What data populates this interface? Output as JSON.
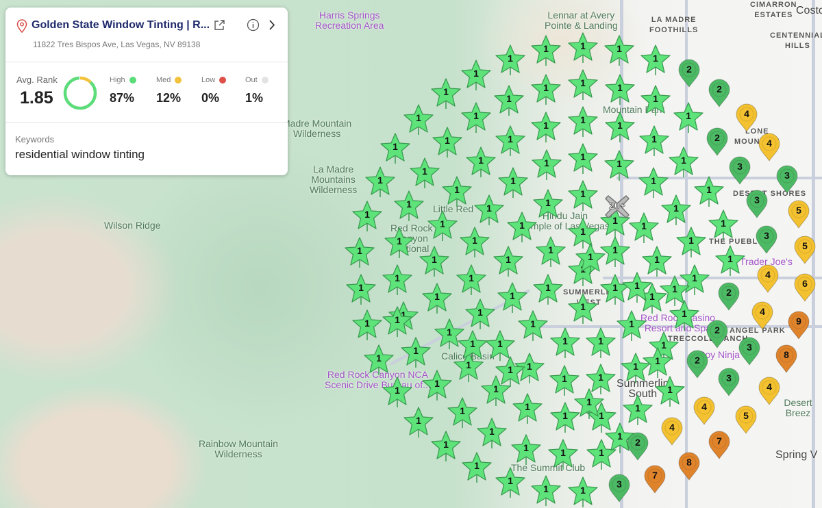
{
  "card": {
    "business_name": "Golden State Window Tinting | R...",
    "address": "11822 Tres Bispos Ave, Las Vegas, NV 89138",
    "avg_rank_label": "Avg. Rank",
    "avg_rank": "1.85",
    "stats": [
      {
        "label": "High",
        "value": "87%",
        "color": "#5ddc7a",
        "fraction": 0.87
      },
      {
        "label": "Med",
        "value": "12%",
        "color": "#f3c23c",
        "fraction": 0.12
      },
      {
        "label": "Low",
        "value": "0%",
        "color": "#e0504a",
        "fraction": 0
      },
      {
        "label": "Out",
        "value": "1%",
        "color": "#e3e3e3",
        "fraction": 0.01
      }
    ],
    "keywords_label": "Keywords",
    "keyword": "residential window tinting"
  },
  "map_labels": [
    "Harris Springs\nRecreation Area",
    "Lennar at Avery\nPointe & Landing",
    "LA MADRE\nFOOTHILLS",
    "CIMARRON\nESTATES",
    "Costc",
    "CENTENNIAL\nHILLS",
    "Madre Mountain\nWilderness",
    "La Madre\nMountains\nWilderness",
    "Wilson Ridge",
    "Little Red",
    "Red Rock\nCanyon\nNational",
    "Hindu Jain\nTemple of Las Vegas",
    "Mountain Park",
    "LONE\nMOUNTAIN",
    "DESERT SHORES",
    "THE PUEBLO",
    "SUMMERLIN\nWEST",
    "Red Rock Casino\nResort and Spa",
    "Calico Basin",
    "Red Rock Canyon NCA\nScenic Drive Bureau of...",
    "Summerlin\nSouth",
    "Rainbow Mountain\nWilderness",
    "The Summit Club",
    "Spring V",
    "Trader Joe's",
    "Soy Ninja",
    "Desert Breez",
    "ANGEL PARK",
    "TRECCOLE RANCH"
  ],
  "cluster_label": "20+",
  "star_ranks": [
    1,
    1,
    1,
    1,
    1,
    1,
    1,
    1,
    1,
    1,
    1,
    1,
    1,
    1,
    1,
    1,
    1,
    1,
    1,
    1,
    1,
    1,
    1,
    1,
    1,
    1,
    1,
    1,
    1,
    1,
    1,
    1,
    1,
    1,
    1,
    1,
    1,
    1,
    1,
    1,
    1,
    1,
    1,
    1,
    1,
    1,
    1,
    1,
    1,
    1,
    1,
    1,
    1,
    1,
    1,
    1,
    1,
    1,
    1,
    1,
    1,
    1,
    1,
    1,
    1,
    1,
    1,
    1,
    1,
    1,
    1,
    1,
    1,
    1,
    1,
    1,
    1,
    1,
    1,
    1,
    1,
    1,
    1,
    1,
    1,
    1,
    1,
    1,
    1,
    1,
    1,
    1,
    1,
    1,
    1,
    1,
    1,
    1,
    1,
    1,
    1,
    1,
    1,
    1,
    1,
    1,
    1,
    1,
    1,
    1,
    1,
    1,
    1
  ],
  "pin_ranks": [
    2,
    2,
    4,
    2,
    4,
    3,
    3,
    3,
    5,
    3,
    5,
    4,
    2,
    6,
    4,
    9,
    2,
    3,
    8,
    2,
    3,
    4,
    4,
    5,
    4,
    2,
    7,
    8,
    7,
    3
  ],
  "colors": {
    "high": "#5ee37a",
    "high_dark": "#4cb964",
    "med": "#f4c230",
    "low": "#e0842c"
  }
}
